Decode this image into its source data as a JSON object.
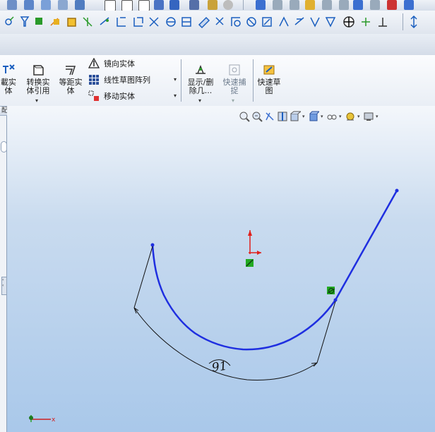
{
  "ribbon": {
    "cut_extrude": {
      "line1": "載实",
      "line2": "体"
    },
    "convert_entities": {
      "line1": "转换实",
      "line2": "体引用"
    },
    "offset_entities": {
      "line1": "等距实",
      "line2": "体"
    },
    "mirror_entities": "镜向实体",
    "linear_pattern": "线性草图阵列",
    "move_entities": "移动实体",
    "display_delete": {
      "line1": "显示/删",
      "line2": "除几..."
    },
    "quick_snaps": {
      "line1": "快速捕",
      "line2": "捉"
    },
    "rapid_sketch": {
      "line1": "快速草",
      "line2": "图"
    }
  },
  "panel_tab": "配置产品",
  "sketch": {
    "dimension_value": "91",
    "line_color": "#1f2fe0"
  },
  "colors": {
    "accent": "#1f2fe0",
    "origin_red": "#e0201c",
    "relation_green": "#22aa22"
  },
  "icons": [
    "search-icon",
    "zoom-icon",
    "view-icon",
    "section-icon",
    "display-style-icon",
    "hide-show-icon",
    "scene-icon",
    "monitor-icon",
    "triad-icon"
  ]
}
